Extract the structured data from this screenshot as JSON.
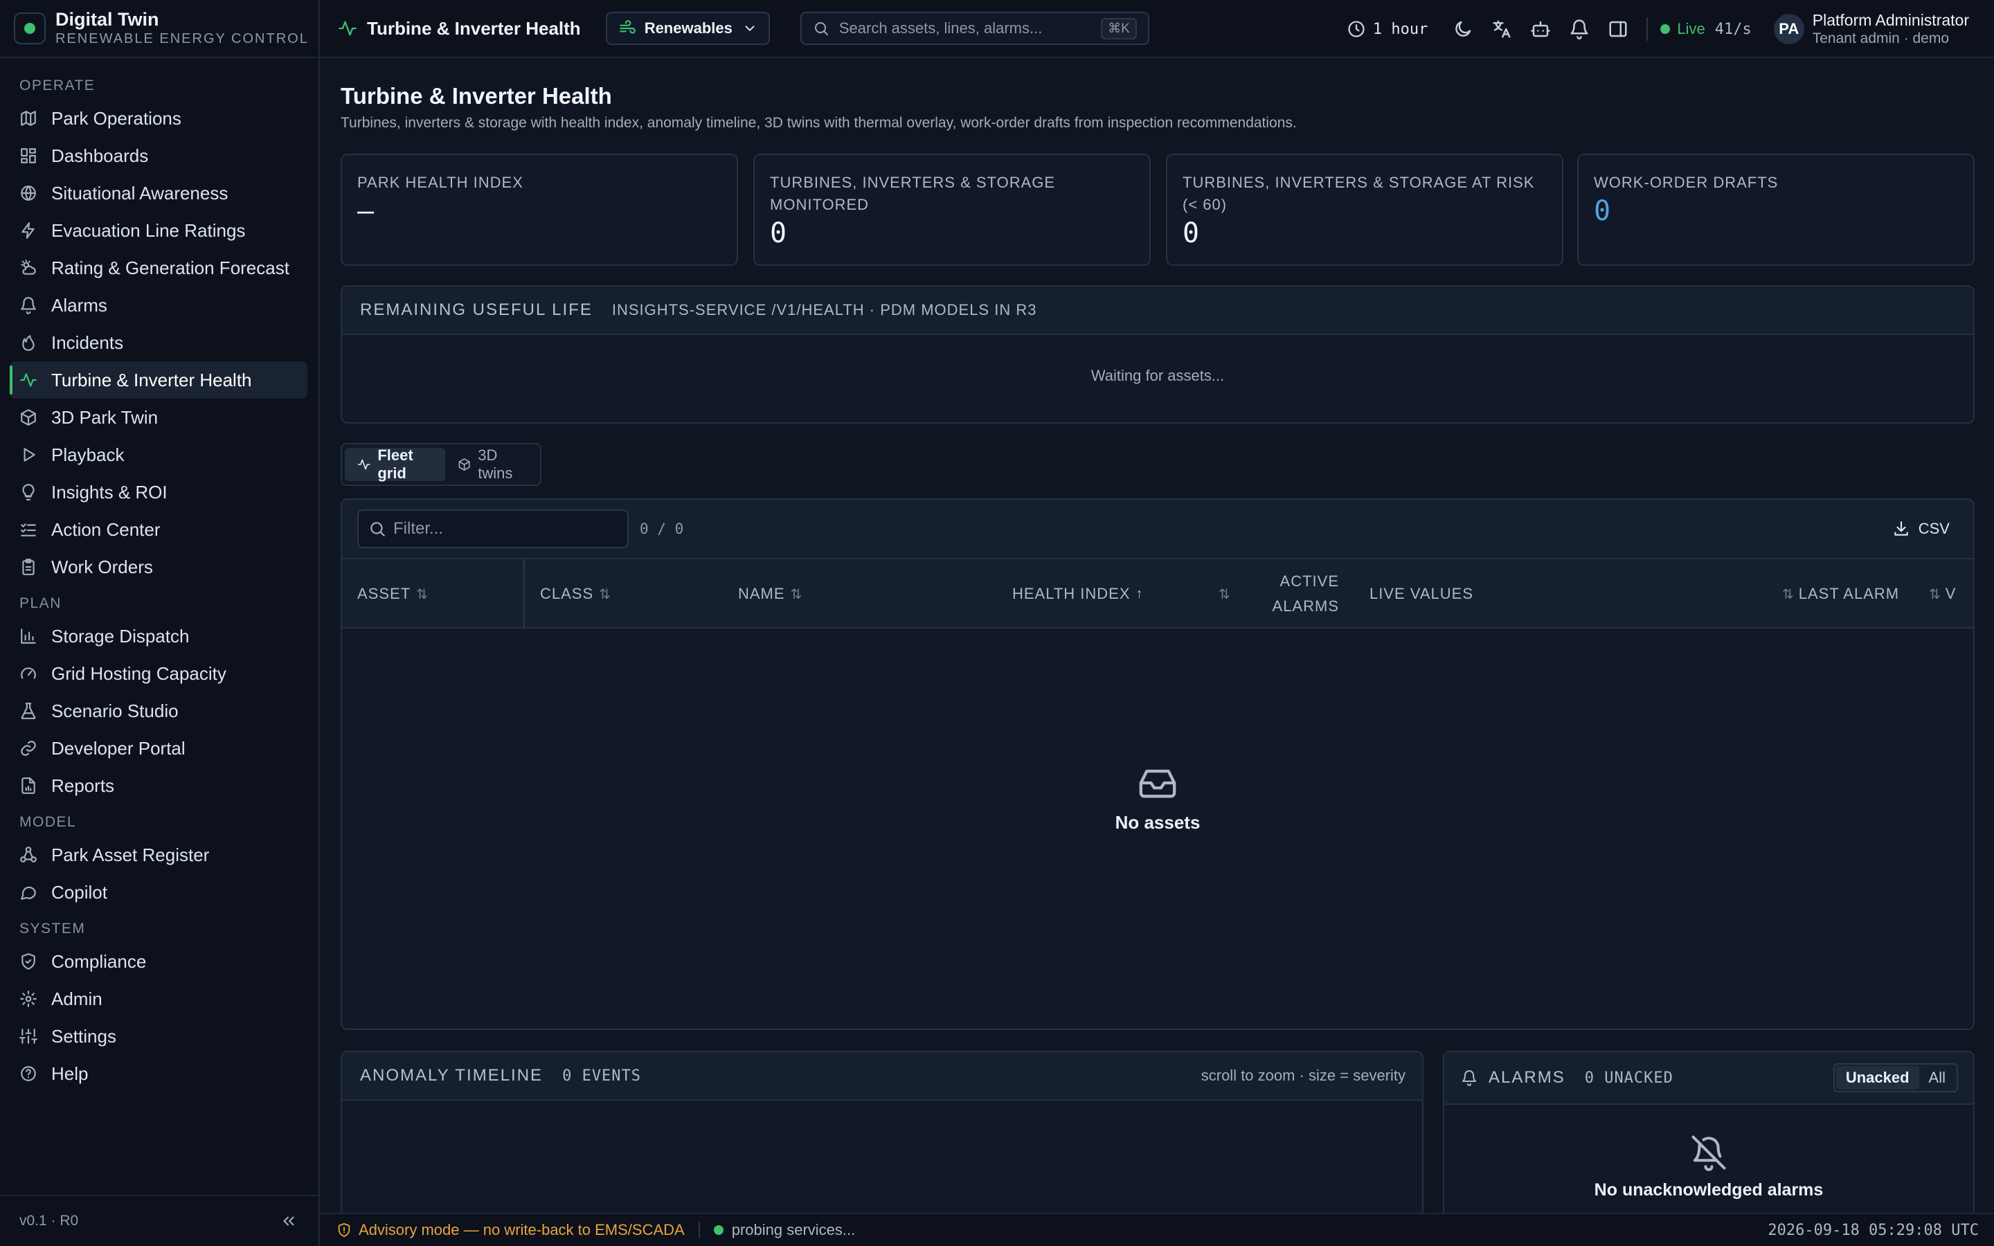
{
  "brand": {
    "title": "Digital Twin",
    "subtitle": "RENEWABLE ENERGY CONTROL"
  },
  "sidebar": {
    "sections": [
      {
        "label": "OPERATE",
        "items": [
          "Park Operations",
          "Dashboards",
          "Situational Awareness",
          "Evacuation Line Ratings",
          "Rating & Generation Forecast",
          "Alarms",
          "Incidents",
          "Turbine & Inverter Health",
          "3D Park Twin",
          "Playback",
          "Insights & ROI",
          "Action Center",
          "Work Orders"
        ]
      },
      {
        "label": "PLAN",
        "items": [
          "Storage Dispatch",
          "Grid Hosting Capacity",
          "Scenario Studio",
          "Developer Portal",
          "Reports"
        ]
      },
      {
        "label": "MODEL",
        "items": [
          "Park Asset Register",
          "Copilot"
        ]
      },
      {
        "label": "SYSTEM",
        "items": [
          "Compliance",
          "Admin",
          "Settings",
          "Help"
        ]
      }
    ],
    "active_item": "Turbine & Inverter Health",
    "version": "v0.1 · R0"
  },
  "topbar": {
    "title": "Turbine & Inverter Health",
    "scope": "Renewables",
    "search_placeholder": "Search assets, lines, alarms...",
    "search_shortcut": "⌘K",
    "time_range": "1 hour",
    "live_label": "Live",
    "live_rate": "41/s",
    "user": {
      "initials": "PA",
      "name": "Platform Administrator",
      "role": "Tenant admin · demo"
    }
  },
  "page": {
    "title": "Turbine & Inverter Health",
    "description": "Turbines, inverters & storage with health index, anomaly timeline, 3D twins with thermal overlay, work-order drafts from inspection recommendations."
  },
  "stats": [
    {
      "label": "PARK HEALTH INDEX",
      "value": "—"
    },
    {
      "label": "TURBINES, INVERTERS & STORAGE MONITORED",
      "value": "0"
    },
    {
      "label": "TURBINES, INVERTERS & STORAGE AT RISK (< 60)",
      "value": "0"
    },
    {
      "label": "WORK-ORDER DRAFTS",
      "value": "0"
    }
  ],
  "rul": {
    "title": "REMAINING USEFUL LIFE",
    "meta": "INSIGHTS-SERVICE /V1/HEALTH · PDM MODELS IN R3",
    "status": "Waiting for assets..."
  },
  "view_tabs": {
    "fleet": "Fleet grid",
    "twins": "3D twins"
  },
  "grid": {
    "filter_placeholder": "Filter...",
    "count": "0 / 0",
    "csv_label": "CSV",
    "columns": {
      "asset": "ASSET",
      "class": "CLASS",
      "name": "NAME",
      "health": "HEALTH INDEX",
      "active_alarms_1": "ACTIVE",
      "active_alarms_2": "ALARMS",
      "live_values": "LIVE VALUES",
      "last_alarm": "LAST ALARM",
      "v": "V"
    },
    "empty": "No assets"
  },
  "anomaly": {
    "title": "ANOMALY TIMELINE",
    "count": "0 EVENTS",
    "hint": "scroll to zoom · size = severity"
  },
  "alarms": {
    "title": "ALARMS",
    "count": "0 UNACKED",
    "tab_unacked": "Unacked",
    "tab_all": "All",
    "empty": "No unacknowledged alarms"
  },
  "status_bar": {
    "advisory": "Advisory mode — no write-back to EMS/SCADA",
    "probe": "probing services...",
    "clock": "2026-09-18 05:29:08 UTC"
  }
}
